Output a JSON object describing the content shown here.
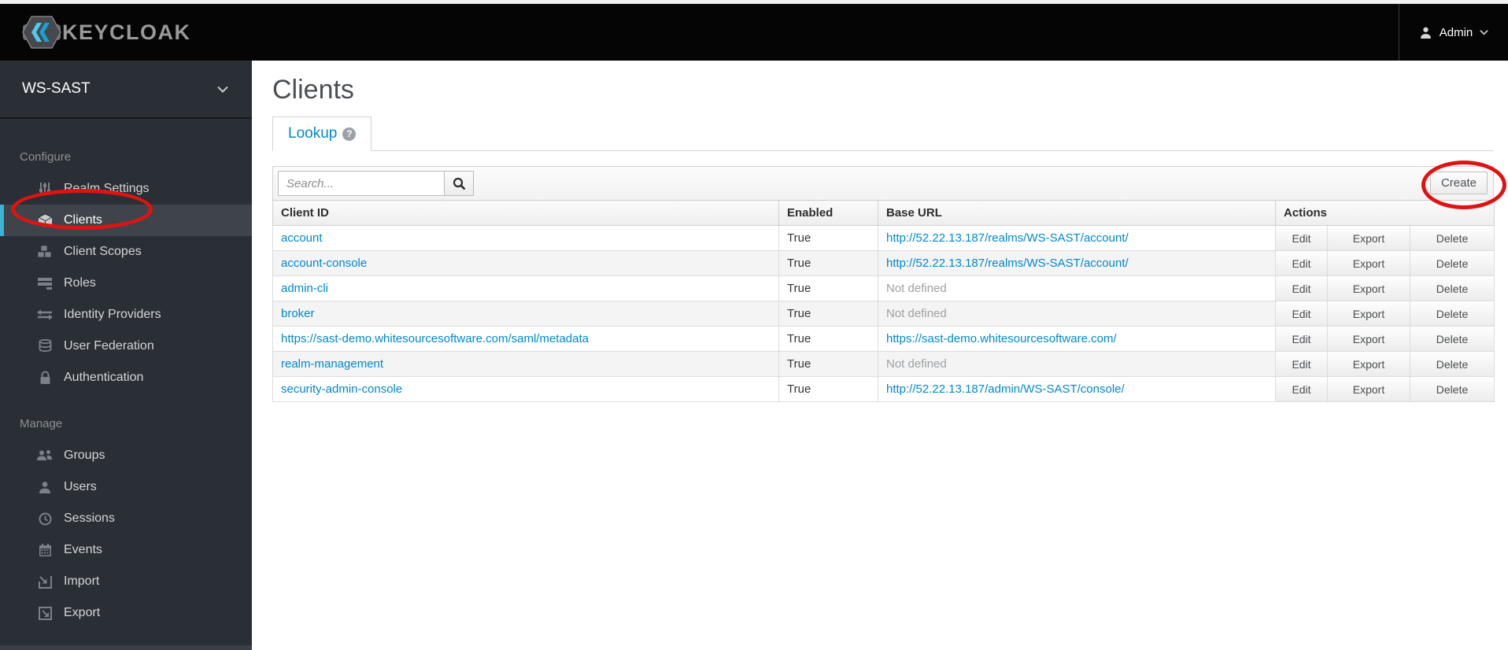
{
  "topbar": {
    "logo_text": "KEYCLOAK",
    "user_label": "Admin"
  },
  "sidebar": {
    "realm": "WS-SAST",
    "sections": [
      {
        "label": "Configure",
        "items": [
          {
            "label": "Realm Settings",
            "icon": "sliders-icon",
            "active": false
          },
          {
            "label": "Clients",
            "icon": "cube-icon",
            "active": true
          },
          {
            "label": "Client Scopes",
            "icon": "cubes-icon",
            "active": false
          },
          {
            "label": "Roles",
            "icon": "list-icon",
            "active": false
          },
          {
            "label": "Identity Providers",
            "icon": "exchange-arrows-icon",
            "active": false
          },
          {
            "label": "User Federation",
            "icon": "database-icon",
            "active": false
          },
          {
            "label": "Authentication",
            "icon": "lock-icon",
            "active": false
          }
        ]
      },
      {
        "label": "Manage",
        "items": [
          {
            "label": "Groups",
            "icon": "users-icon",
            "active": false
          },
          {
            "label": "Users",
            "icon": "user-icon",
            "active": false
          },
          {
            "label": "Sessions",
            "icon": "clock-icon",
            "active": false
          },
          {
            "label": "Events",
            "icon": "calendar-icon",
            "active": false
          },
          {
            "label": "Import",
            "icon": "import-icon",
            "active": false
          },
          {
            "label": "Export",
            "icon": "export-icon",
            "active": false
          }
        ]
      }
    ]
  },
  "main": {
    "title": "Clients",
    "tabs": [
      {
        "label": "Lookup",
        "active": true,
        "help_icon": "?"
      }
    ],
    "toolbar": {
      "search_placeholder": "Search...",
      "create_label": "Create"
    },
    "table": {
      "headers": [
        "Client ID",
        "Enabled",
        "Base URL",
        "Actions"
      ],
      "action_labels": [
        "Edit",
        "Export",
        "Delete"
      ],
      "rows": [
        {
          "client_id": "account",
          "enabled": "True",
          "base_url": "http://52.22.13.187/realms/WS-SAST/account/",
          "base_url_is_link": true
        },
        {
          "client_id": "account-console",
          "enabled": "True",
          "base_url": "http://52.22.13.187/realms/WS-SAST/account/",
          "base_url_is_link": true
        },
        {
          "client_id": "admin-cli",
          "enabled": "True",
          "base_url": "Not defined",
          "base_url_is_link": false
        },
        {
          "client_id": "broker",
          "enabled": "True",
          "base_url": "Not defined",
          "base_url_is_link": false
        },
        {
          "client_id": "https://sast-demo.whitesourcesoftware.com/saml/metadata",
          "enabled": "True",
          "base_url": "https://sast-demo.whitesourcesoftware.com/",
          "base_url_is_link": true
        },
        {
          "client_id": "realm-management",
          "enabled": "True",
          "base_url": "Not defined",
          "base_url_is_link": false
        },
        {
          "client_id": "security-admin-console",
          "enabled": "True",
          "base_url": "http://52.22.13.187/admin/WS-SAST/console/",
          "base_url_is_link": true
        }
      ]
    }
  },
  "annotations": {
    "color": "#e01212"
  },
  "colors": {
    "accent_blue": "#0088ce",
    "sidebar_active_border": "#39b3d7",
    "topbar_bg": "#050505",
    "sidebar_bg": "#2a2f35"
  }
}
